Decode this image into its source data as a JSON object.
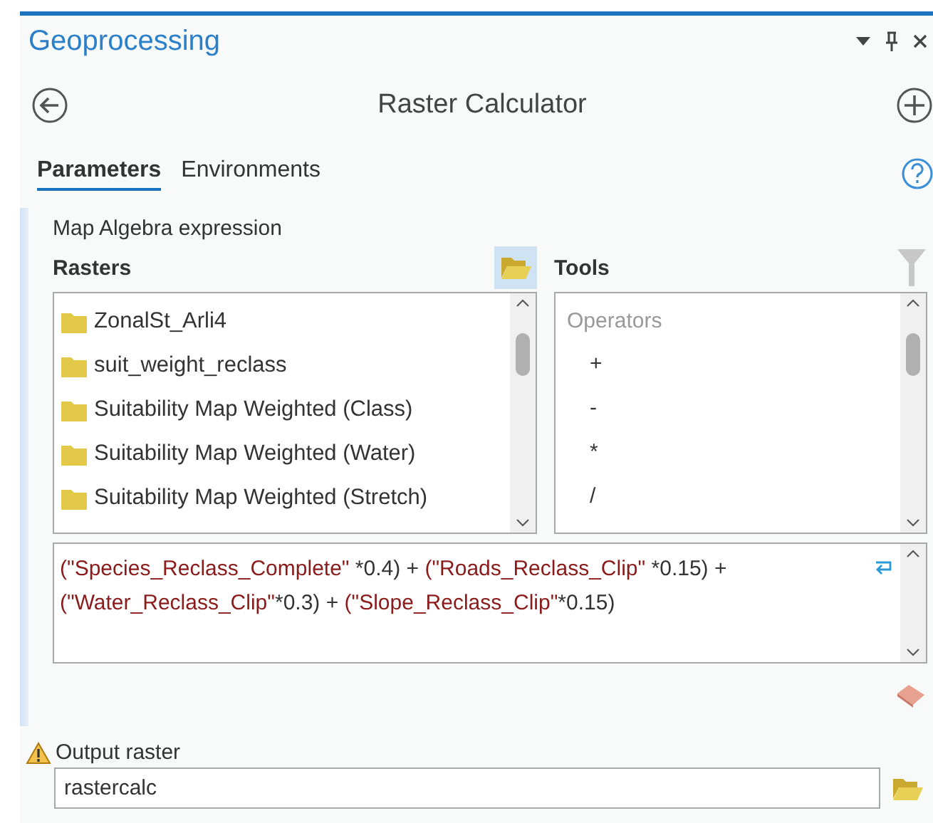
{
  "pane": {
    "title": "Geoprocessing"
  },
  "tool": {
    "title": "Raster Calculator"
  },
  "tabs": [
    {
      "label": "Parameters",
      "selected": true
    },
    {
      "label": "Environments",
      "selected": false
    }
  ],
  "expression_section": {
    "label": "Map Algebra expression",
    "rasters": {
      "label": "Rasters",
      "items": [
        "ZonalSt_Arli4",
        "suit_weight_reclass",
        "Suitability Map Weighted (Class)",
        "Suitability Map Weighted (Water)",
        "Suitability Map Weighted (Stretch)"
      ]
    },
    "tools": {
      "label": "Tools",
      "group": "Operators",
      "items": [
        "+",
        "-",
        "*",
        "/"
      ]
    },
    "expression": [
      [
        {
          "kind": "paren",
          "text": "("
        },
        {
          "kind": "string",
          "text": "\"Species_Reclass_Complete\""
        },
        {
          "kind": "op",
          "text": " *0.4) + "
        },
        {
          "kind": "paren",
          "text": "("
        },
        {
          "kind": "string",
          "text": "\"Roads_Reclass_Clip\""
        },
        {
          "kind": "op",
          "text": " *0.15) +"
        }
      ],
      [
        {
          "kind": "paren",
          "text": "("
        },
        {
          "kind": "string",
          "text": "\"Water_Reclass_Clip\""
        },
        {
          "kind": "op",
          "text": "*0.3) + "
        },
        {
          "kind": "paren",
          "text": "("
        },
        {
          "kind": "string",
          "text": "\"Slope_Reclass_Clip\""
        },
        {
          "kind": "op",
          "text": "*0.15)"
        }
      ]
    ]
  },
  "output": {
    "label": "Output raster",
    "warning": true,
    "value": "rastercalc"
  }
}
